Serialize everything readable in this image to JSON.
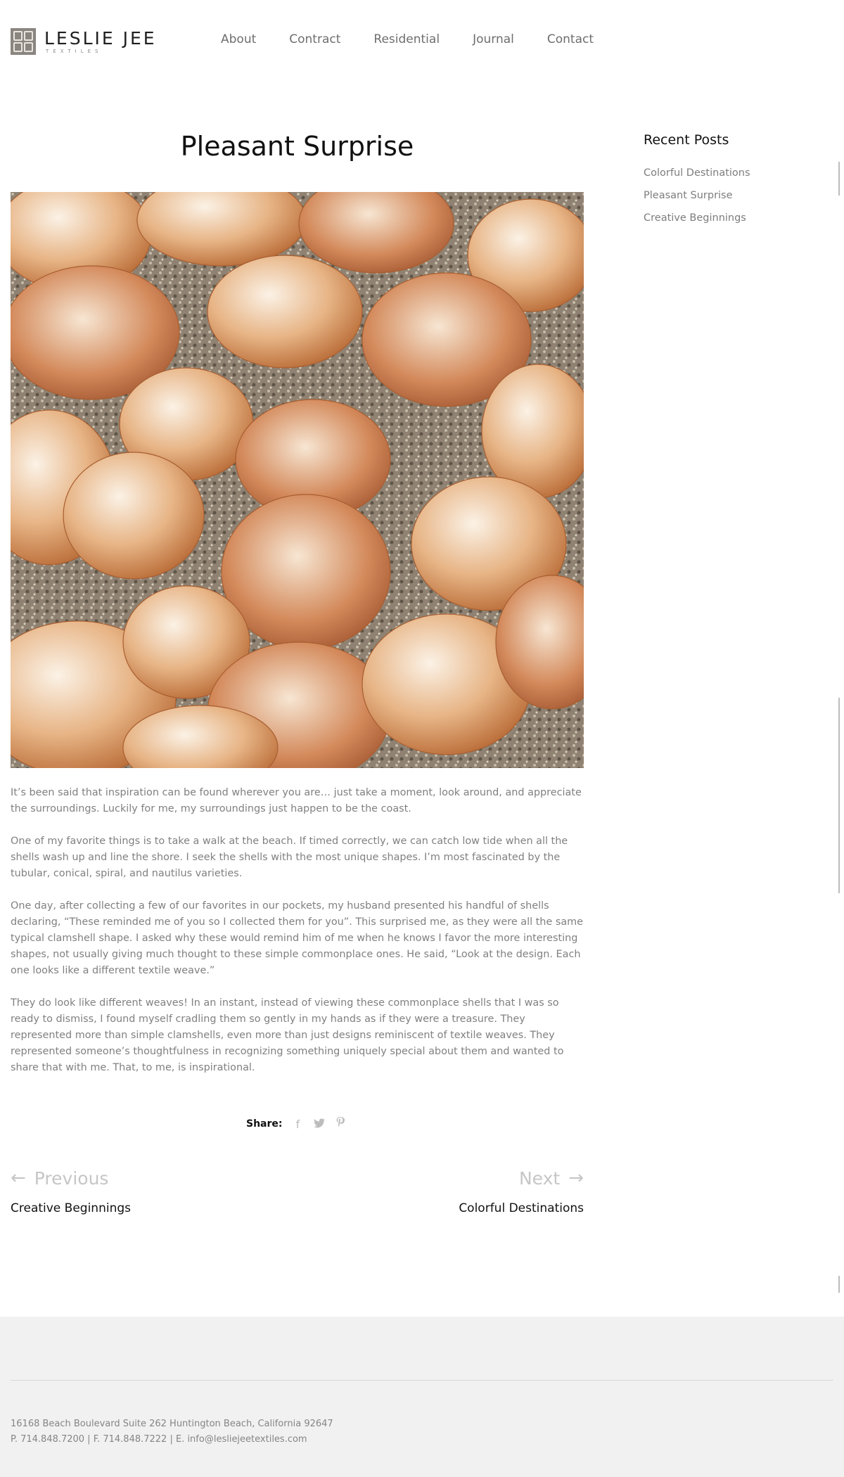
{
  "brand": {
    "name": "LESLIE JEE",
    "sub": "TEXTILES"
  },
  "nav": {
    "items": [
      {
        "label": "About"
      },
      {
        "label": "Contract"
      },
      {
        "label": "Residential"
      },
      {
        "label": "Journal"
      },
      {
        "label": "Contact"
      }
    ]
  },
  "article": {
    "title": "Pleasant Surprise",
    "paragraphs": [
      "It’s been said that inspiration can be found wherever you are… just take a moment, look around, and appreciate the surroundings. Luckily for me, my surroundings just happen to be the coast.",
      "One of my favorite things is to take a walk at the beach. If timed correctly, we can catch low tide when all the shells wash up and line the shore. I seek the shells with the most unique shapes. I’m most fascinated by the tubular, conical, spiral, and nautilus varieties.",
      "One day, after collecting a few of our favorites in our pockets, my husband presented his handful of shells declaring, “These reminded me of you so I collected them for you”. This surprised me, as they were all the same typical clamshell shape. I asked why these would remind him of me when he knows I favor the more interesting shapes, not usually giving much thought to these simple commonplace ones. He said, “Look at the design. Each one looks like a different textile weave.”",
      "They do look like different weaves! In an instant, instead of viewing these commonplace shells that I was so ready to dismiss, I found myself cradling them so gently in my hands as if they were a treasure. They represented more than simple clamshells, even more than just designs reminiscent of textile weaves. They represented someone’s thoughtfulness in recognizing something uniquely special about them and wanted to share that with me. That, to me, is inspirational."
    ]
  },
  "share": {
    "label": "Share:",
    "icons": [
      "facebook-icon",
      "twitter-icon",
      "pinterest-icon"
    ]
  },
  "pagination": {
    "prev_label": "Previous",
    "prev_title": "Creative Beginnings",
    "next_label": "Next",
    "next_title": "Colorful Destinations"
  },
  "sidebar": {
    "heading": "Recent Posts",
    "posts": [
      {
        "label": "Colorful Destinations"
      },
      {
        "label": "Pleasant Surprise"
      },
      {
        "label": "Creative Beginnings"
      }
    ]
  },
  "footer": {
    "address": "16168 Beach Boulevard Suite 262 Huntington Beach, California 92647",
    "contact": "P. 714.848.7200 | F. 714.848.7222 | E. info@lesliejeetextiles.com"
  },
  "colors": {
    "text_dark": "#111111",
    "text_muted": "#808080",
    "footer_bg": "#f1f1f1"
  }
}
